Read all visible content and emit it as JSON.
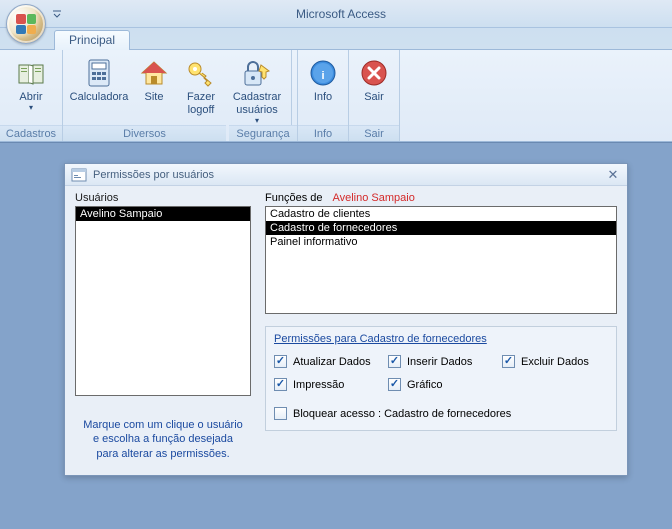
{
  "app": {
    "title": "Microsoft Access"
  },
  "ribbon": {
    "tab": "Principal",
    "groups": {
      "cadastros": {
        "label": "Cadastros",
        "abrir": "Abrir"
      },
      "diversos": {
        "label": "Diversos",
        "calculadora": "Calculadora",
        "site": "Site",
        "logoff": "Fazer\nlogoff",
        "cadastrar": "Cadastrar\nusuários"
      },
      "seguranca": {
        "label": "Segurança"
      },
      "info": {
        "label": "Info",
        "info": "Info"
      },
      "sair": {
        "label": "Sair",
        "sair": "Sair"
      }
    }
  },
  "form": {
    "title": "Permissões por usuários",
    "usuarios_label": "Usuários",
    "usuarios": [
      "Avelino Sampaio"
    ],
    "usuarios_sel": 0,
    "funcoes_label": "Funções de",
    "funcoes_user": "Avelino Sampaio",
    "funcoes": [
      "Cadastro de clientes",
      "Cadastro de fornecedores",
      "Painel informativo"
    ],
    "funcoes_sel": 1,
    "perm_title": "Permissões para Cadastro de fornecedores",
    "perm": {
      "atualizar": {
        "label": "Atualizar Dados",
        "checked": true
      },
      "inserir": {
        "label": "Inserir Dados",
        "checked": true
      },
      "excluir": {
        "label": "Excluir Dados",
        "checked": true
      },
      "impressao": {
        "label": "Impressão",
        "checked": true
      },
      "grafico": {
        "label": "Gráfico",
        "checked": true
      }
    },
    "block": {
      "label": "Bloquear acesso : Cadastro de fornecedores",
      "checked": false
    },
    "hint": "Marque com um clique o usuário\ne escolha a função desejada\npara alterar as permissões."
  }
}
